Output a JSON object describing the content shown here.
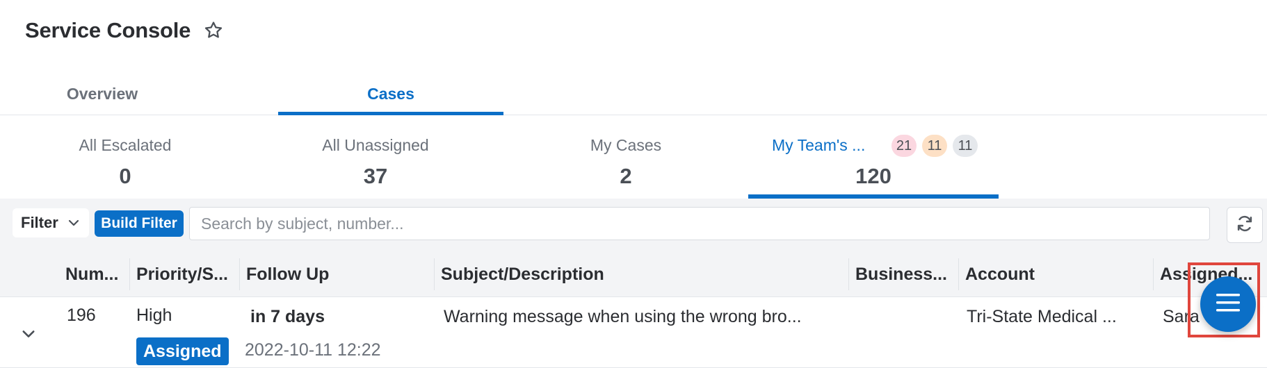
{
  "header": {
    "title": "Service Console",
    "favorite_icon": "star-outline-icon"
  },
  "main_tabs": [
    {
      "label": "Overview",
      "active": false
    },
    {
      "label": "Cases",
      "active": true
    }
  ],
  "dashlet_tabs": [
    {
      "label": "All Escalated",
      "count": "0",
      "active": false
    },
    {
      "label": "All Unassigned",
      "count": "37",
      "active": false
    },
    {
      "label": "My Cases",
      "count": "2",
      "active": false
    },
    {
      "label": "My Team's ...",
      "count": "120",
      "active": true,
      "badges": [
        {
          "value": "21",
          "color": "#fbd7e0"
        },
        {
          "value": "11",
          "color": "#fde0c5"
        },
        {
          "value": "11",
          "color": "#e5e8ec"
        }
      ]
    }
  ],
  "filter_bar": {
    "filter_label": "Filter",
    "build_filter_label": "Build Filter",
    "search_placeholder": "Search by subject, number...",
    "search_value": "",
    "refresh_icon": "refresh-icon"
  },
  "table": {
    "columns": [
      "Num...",
      "Priority/S...",
      "Follow Up",
      "Subject/Description",
      "Business...",
      "Account",
      "Assigned..."
    ],
    "rows": [
      {
        "number": "196",
        "priority": "High",
        "status": "Assigned",
        "follow_up": "in 7 days",
        "follow_up_date": "2022-10-11 12:22",
        "subject": "Warning message when using the wrong bro...",
        "business": "",
        "account": "Tri-State Medical ...",
        "assigned": "Sara"
      }
    ]
  },
  "fab": {
    "icon": "menu-icon"
  },
  "colors": {
    "accent": "#0b6fc7",
    "highlight": "#e0463d",
    "panel": "#f3f4f6"
  }
}
